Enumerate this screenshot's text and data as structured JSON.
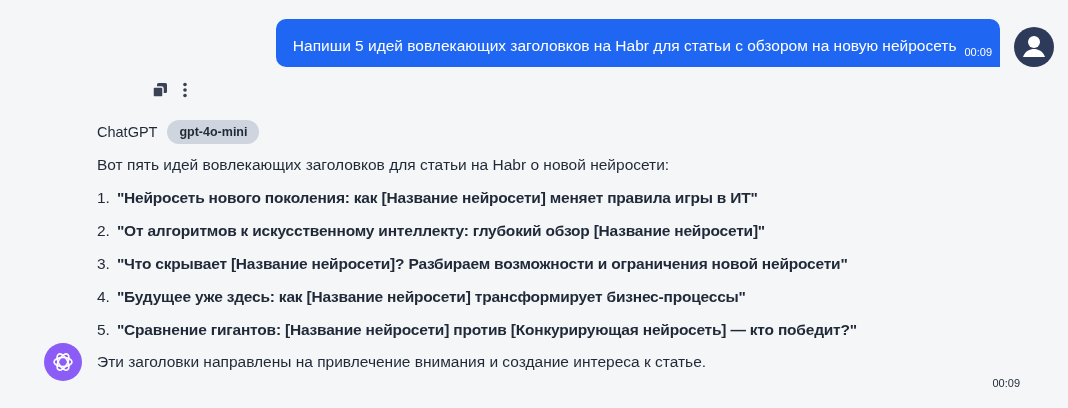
{
  "user_message": {
    "text": "Напиши 5 идей вовлекающих заголовков на Habr для статьи с обзором на новую нейросеть",
    "time": "00:09"
  },
  "assistant_message": {
    "sender": "ChatGPT",
    "model": "gpt-4o-mini",
    "intro": "Вот пять идей вовлекающих заголовков для статьи на Habr о новой нейросети:",
    "items": [
      {
        "number": "1.",
        "text": "\"Нейросеть нового поколения: как [Название нейросети] меняет правила игры в ИТ\""
      },
      {
        "number": "2.",
        "text": "\"От алгоритмов к искусственному интеллекту: глубокий обзор [Название нейросети]\""
      },
      {
        "number": "3.",
        "text": "\"Что скрывает [Название нейросети]? Разбираем возможности и ограничения новой нейросети\""
      },
      {
        "number": "4.",
        "text": "\"Будущее уже здесь: как [Название нейросети] трансформирует бизнес-процессы\""
      },
      {
        "number": "5.",
        "text": "\"Сравнение гигантов: [Название нейросети] против [Конкурирующая нейросеть] — кто победит?\""
      }
    ],
    "outro": "Эти заголовки направлены на привлечение внимания и создание интереса к статье.",
    "time": "00:09"
  }
}
